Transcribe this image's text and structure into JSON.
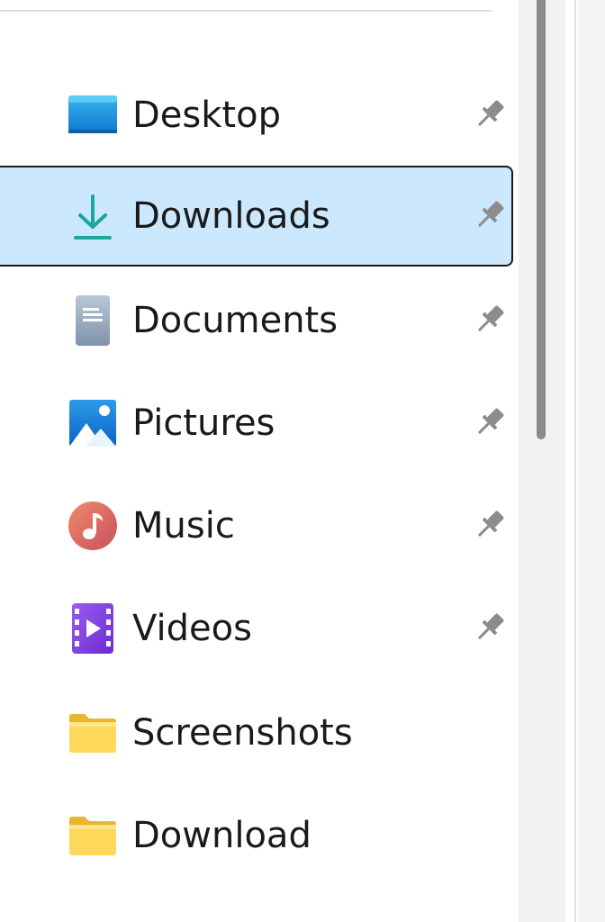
{
  "nav": {
    "items": [
      {
        "label": "Desktop",
        "icon": "desktop-icon",
        "pinned": true,
        "selected": false
      },
      {
        "label": "Downloads",
        "icon": "downloads-icon",
        "pinned": true,
        "selected": true
      },
      {
        "label": "Documents",
        "icon": "documents-icon",
        "pinned": true,
        "selected": false
      },
      {
        "label": "Pictures",
        "icon": "pictures-icon",
        "pinned": true,
        "selected": false
      },
      {
        "label": "Music",
        "icon": "music-icon",
        "pinned": true,
        "selected": false
      },
      {
        "label": "Videos",
        "icon": "videos-icon",
        "pinned": true,
        "selected": false
      },
      {
        "label": "Screenshots",
        "icon": "folder-icon",
        "pinned": false,
        "selected": false
      },
      {
        "label": "Download",
        "icon": "folder-icon",
        "pinned": false,
        "selected": false
      }
    ]
  },
  "colors": {
    "selected_background": "#cce8ff",
    "selected_border": "#1a1a1a",
    "text": "#1a1a1a",
    "pin": "#8c8c8c"
  }
}
